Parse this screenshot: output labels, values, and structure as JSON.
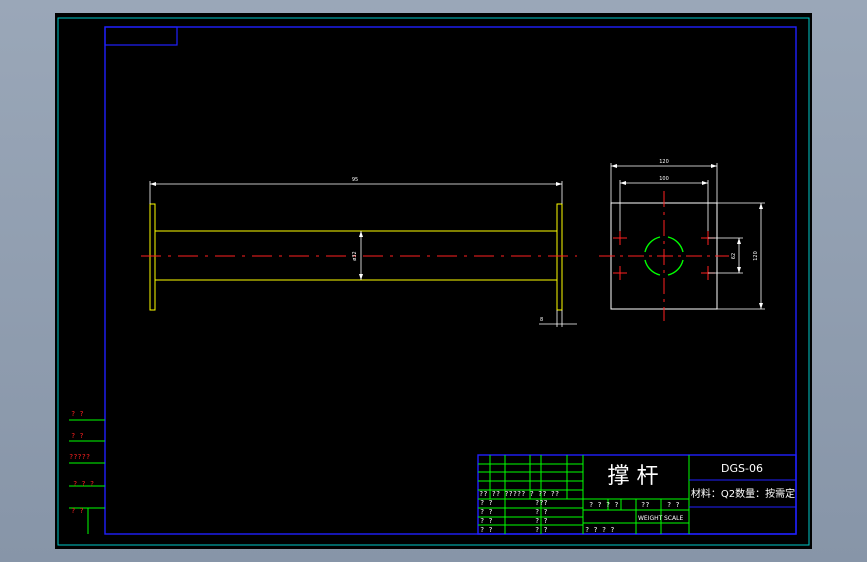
{
  "title_block": {
    "part_name": "撑 杆",
    "drawing_no": "DGS-06",
    "material_quantity": "材料：Q2数量：按需定",
    "weight_label": "WEIGHT",
    "scale_label": "SCALE",
    "header_left": "?? ?? ????? ? ?? ??",
    "row1_left": "? ?",
    "row1_mid": "???",
    "row2_left": "? ?",
    "row2_mid": "? ?",
    "row3_left": "? ?",
    "row3_mid": "? ?",
    "row4_left": "? ?",
    "row4_mid": "? ?",
    "mid_row1": "? ? ? ?",
    "mid_row1_b": "??",
    "mid_row1_c": "? ?",
    "mid_row2_b": "? ?",
    "bottom_row": "? ? ? ?"
  },
  "side_table": {
    "rows": [
      "? ?",
      "? ?",
      "?????",
      "? ? ?",
      "? ?"
    ]
  },
  "dimensions": {
    "length": "95",
    "tube_dia": "ø32",
    "flange_thk": "8",
    "flange_width": "120",
    "bolt_spacing": "100",
    "flange_height": "120",
    "bolt_vertical": "62"
  },
  "colors": {
    "outer_frame": "#00c8c8",
    "inner_frame": "#2020ff",
    "part_lines": "#ffff00",
    "dim_lines": "#ffffff",
    "center_lines": "#ff2020",
    "bore_arc": "#00ff00",
    "table_lines": "#00ff00"
  }
}
